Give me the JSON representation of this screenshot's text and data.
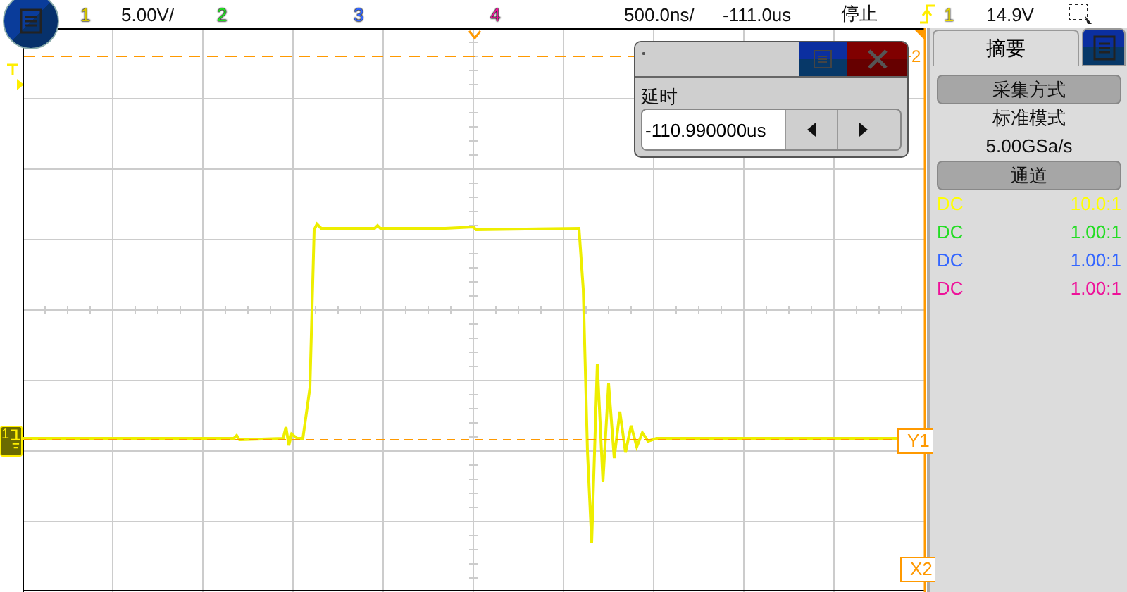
{
  "top_bar": {
    "channels": [
      {
        "label": "1",
        "color": "#d8c800",
        "scale": "5.00V/"
      },
      {
        "label": "2",
        "color": "#22dd22"
      },
      {
        "label": "3",
        "color": "#3366ff"
      },
      {
        "label": "4",
        "color": "#ee1199"
      }
    ],
    "timebase": "500.0ns/",
    "delay": "-111.0us",
    "run_state": "停止",
    "trigger": {
      "source": "1",
      "level": "14.9V"
    }
  },
  "scope": {
    "ground_marker": "1",
    "cursors": [
      {
        "label": "2"
      },
      {
        "label": "Y1"
      },
      {
        "label": "X2"
      }
    ]
  },
  "delay_dialog": {
    "label": "延时",
    "value": "-110.990000us"
  },
  "side_panel": {
    "tab": "摘要",
    "sections": [
      {
        "heading": "采集方式",
        "lines": [
          "标准模式",
          "5.00GSa/s"
        ]
      },
      {
        "heading": "通道",
        "rows": [
          {
            "coupling": "DC",
            "probe": "10.0:1",
            "color": "#ffff00"
          },
          {
            "coupling": "DC",
            "probe": "1.00:1",
            "color": "#22dd22"
          },
          {
            "coupling": "DC",
            "probe": "1.00:1",
            "color": "#3366ff"
          },
          {
            "coupling": "DC",
            "probe": "1.00:1",
            "color": "#ee1199"
          }
        ]
      }
    ]
  }
}
